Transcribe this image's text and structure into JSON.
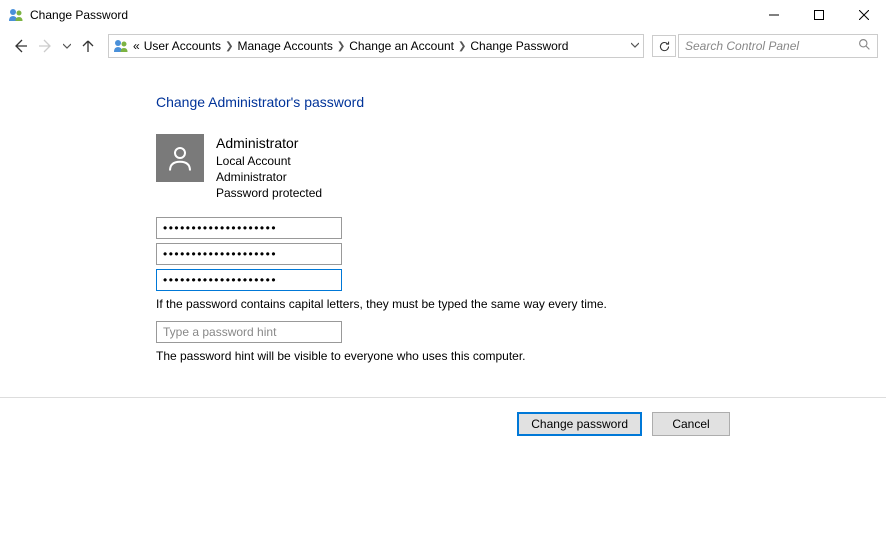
{
  "window": {
    "title": "Change Password"
  },
  "breadcrumb": {
    "prefix": "«",
    "items": [
      "User Accounts",
      "Manage Accounts",
      "Change an Account",
      "Change Password"
    ]
  },
  "search": {
    "placeholder": "Search Control Panel"
  },
  "page": {
    "heading": "Change Administrator's password",
    "user": {
      "name": "Administrator",
      "lines": [
        "Local Account",
        "Administrator",
        "Password protected"
      ]
    },
    "password_fields": {
      "current": "••••••••••••••••••••",
      "new": "••••••••••••••••••••",
      "confirm": "••••••••••••••••••••"
    },
    "caps_note": "If the password contains capital letters, they must be typed the same way every time.",
    "hint_placeholder": "Type a password hint",
    "hint_note": "The password hint will be visible to everyone who uses this computer."
  },
  "buttons": {
    "primary": "Change password",
    "secondary": "Cancel"
  }
}
